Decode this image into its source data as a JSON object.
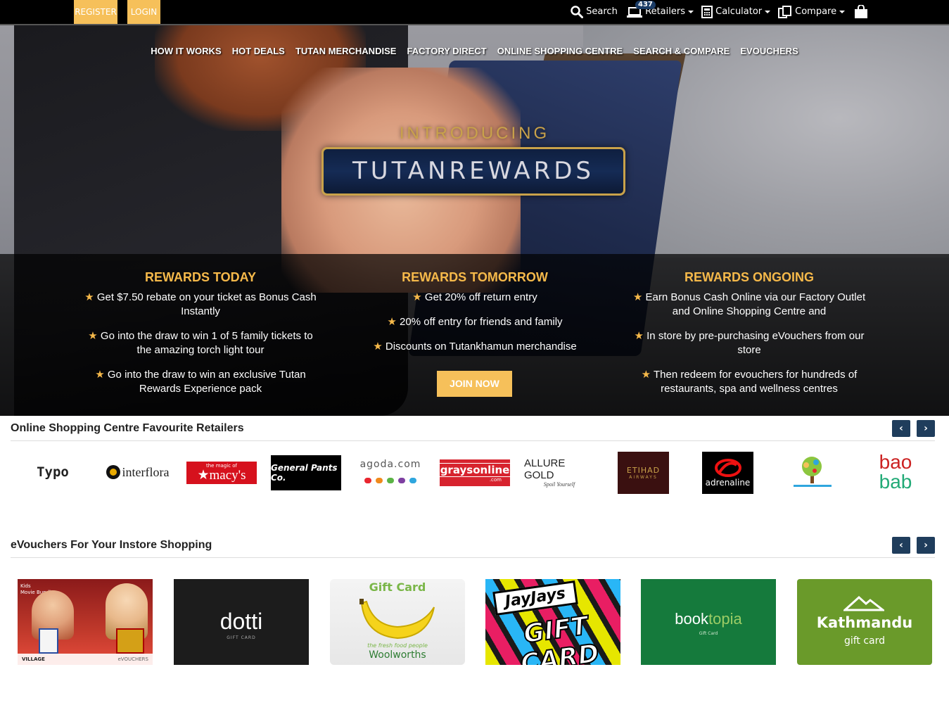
{
  "topbar": {
    "register": "REGISTER",
    "login": "LOGIN",
    "search": "Search",
    "retailers": "Retailers",
    "retailers_count": "437",
    "calculator": "Calculator",
    "compare": "Compare"
  },
  "nav": [
    "HOW IT WORKS",
    "HOT DEALS",
    "TUTAN MERCHANDISE",
    "FACTORY DIRECT",
    "ONLINE SHOPPING CENTRE",
    "SEARCH & COMPARE",
    "EVOUCHERS"
  ],
  "hero": {
    "introducing": "INTRODUCING",
    "brand": "TUTANREWARDS"
  },
  "rewards": [
    {
      "title": "REWARDS TODAY",
      "items": [
        "Get $7.50 rebate on your ticket as Bonus Cash Instantly",
        "Go into the draw to win 1 of 5 family tickets to the amazing torch light tour",
        "Go into the draw to win an exclusive Tutan Rewards Experience pack"
      ]
    },
    {
      "title": "REWARDS TOMORROW",
      "items": [
        "Get 20% off return entry",
        "20% off entry for friends and family",
        "Discounts on Tutankhamun merchandise"
      ]
    },
    {
      "title": "REWARDS ONGOING",
      "items": [
        "Earn Bonus Cash Online via our Factory Outlet and Online Shopping Centre and",
        "In store by pre-purchasing eVouchers from our store",
        "Then redeem for evouchers for hundreds of restaurants, spa and wellness centres"
      ]
    }
  ],
  "join_label": "JOIN NOW",
  "retailers_section": {
    "title": "Online Shopping Centre Favourite Retailers",
    "logos": [
      "Typo",
      "interflora",
      "the magic of",
      "macy's",
      "General Pants Co.",
      "agoda.com",
      "graysonline",
      ".com",
      "ALLURE GOLD",
      "Spoil Yourself",
      "ETIHAD",
      "AIRWAYS",
      "adrenaline",
      "bao",
      "bab"
    ]
  },
  "evouchers_section": {
    "title": "eVouchers For Your Instore Shopping",
    "cards": [
      {
        "top": "Kids",
        "sub": "Movie Bundle",
        "brand": "VILLAGE",
        "extra": "eVOUCHERS"
      },
      {
        "brand": "dotti",
        "sub": "GIFT CARD"
      },
      {
        "top": "Gift Card",
        "tag": "the fresh food people",
        "brand": "Woolworths"
      },
      {
        "brand": "JayJays",
        "sub": "GIFT CARD"
      },
      {
        "brand1": "book",
        "brand2": "topia",
        "sub": "Gift Card"
      },
      {
        "brand": "Kathmandu",
        "sub": "gift card"
      }
    ]
  },
  "colors": {
    "accent": "#f6c05a",
    "gold_title": "#f6b94a",
    "arrow_bg": "#1f3d5c"
  }
}
